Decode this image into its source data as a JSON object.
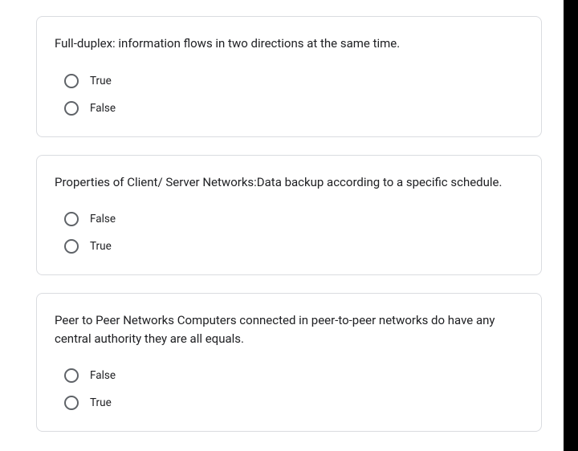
{
  "questions": [
    {
      "text": "Full-duplex: information flows in two directions at the same time.",
      "options": [
        "True",
        "False"
      ]
    },
    {
      "text": "Properties of Client/ Server Networks:Data backup according to a specific schedule.",
      "options": [
        "False",
        "True"
      ]
    },
    {
      "text": "Peer to Peer Networks Computers connected in peer-to-peer networks do have any central authority they are all equals.",
      "options": [
        "False",
        "True"
      ]
    }
  ]
}
